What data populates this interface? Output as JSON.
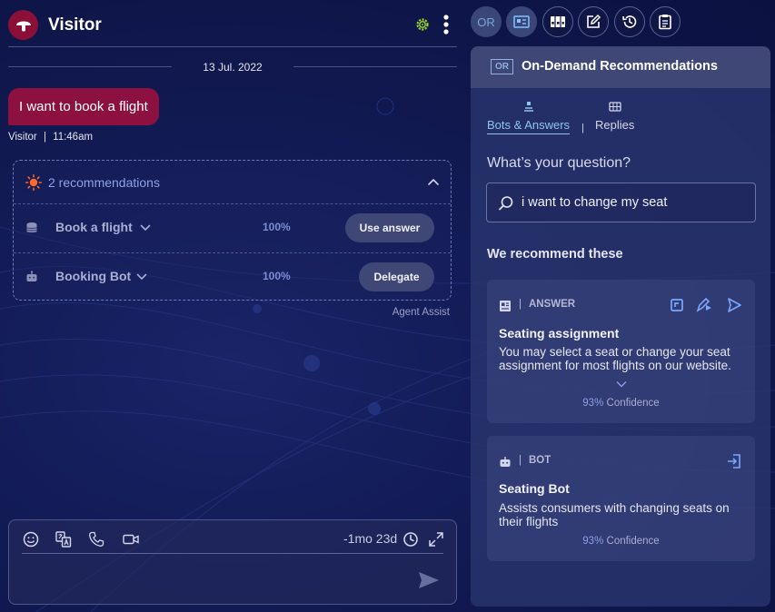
{
  "chat": {
    "visitor_name": "Visitor",
    "date": "13 Jul. 2022",
    "message": {
      "text": "I want to book a flight",
      "sender": "Visitor",
      "separator": "|",
      "time": "11:46am"
    },
    "recommendations": {
      "count_label": "2 recommendations",
      "items": [
        {
          "name": "Book a flight",
          "percent": "100%",
          "action": "Use answer",
          "icon": "database-icon"
        },
        {
          "name": "Booking Bot",
          "percent": "100%",
          "action": "Delegate",
          "icon": "bot-icon"
        }
      ]
    },
    "agent_assist_label": "Agent Assist",
    "composer": {
      "timer": "-1mo 23d"
    }
  },
  "toolbar": {
    "or_label": "OR",
    "buttons": [
      "or-button",
      "on-demand-recommendations-icon",
      "knowledge-icon",
      "edit-icon",
      "history-icon",
      "clipboard-icon"
    ]
  },
  "panel": {
    "tag": "OR",
    "title": "On-Demand Recommendations",
    "tabs": [
      {
        "label": "Bots & Answers",
        "active": true
      },
      {
        "label": "Replies",
        "active": false
      }
    ],
    "tab_separator": "|",
    "question_label": "What’s your question?",
    "search_value": "i want to change my seat",
    "recommend_title": "We recommend these",
    "cards": [
      {
        "type": "ANSWER",
        "separator": "|",
        "title": "Seating assignment",
        "description": "You may select a seat or change your seat assignment for most flights on our website.",
        "confidence_pct": "93%",
        "confidence_label": "Confidence"
      },
      {
        "type": "BOT",
        "separator": "|",
        "title": "Seating Bot",
        "description": "Assists consumers with changing seats on their flights",
        "confidence_pct": "93%",
        "confidence_label": "Confidence"
      }
    ]
  },
  "colors": {
    "background": "#111a52",
    "message_bubble": "#8c1040",
    "accent_blue": "#8ea0e8",
    "active_tab": "#8fc4ea",
    "status_green": "#9bd22a",
    "sun_orange": "#ff6a2a"
  }
}
